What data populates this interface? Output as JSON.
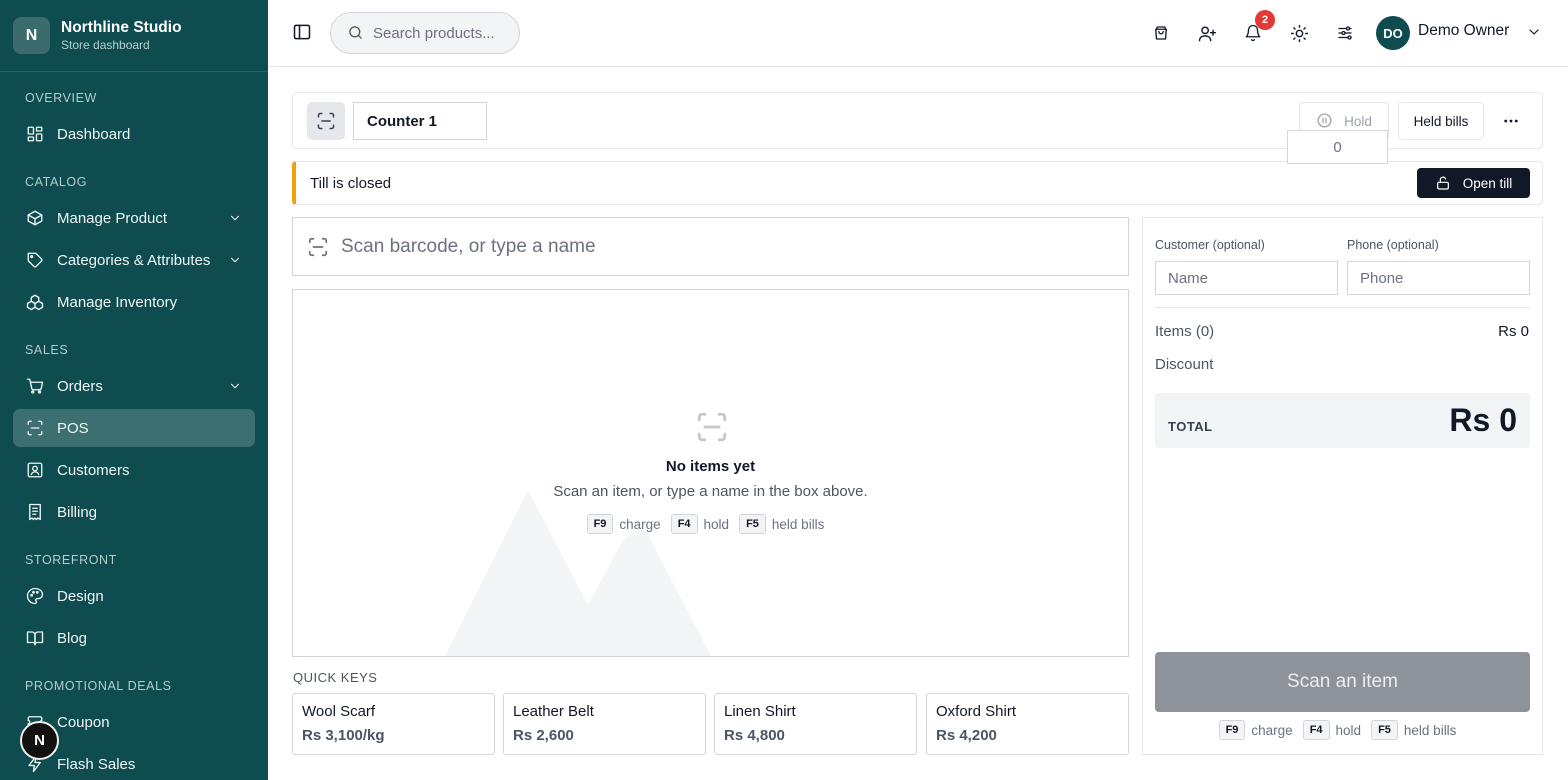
{
  "brand": {
    "initial": "N",
    "name": "Northline Studio",
    "subtitle": "Store dashboard"
  },
  "sidebar": {
    "sections": [
      {
        "label": "OVERVIEW"
      },
      {
        "label": "CATALOG"
      },
      {
        "label": "SALES"
      },
      {
        "label": "STOREFRONT"
      },
      {
        "label": "PROMOTIONAL DEALS"
      }
    ],
    "items": [
      {
        "label": "Dashboard",
        "icon": "grid-icon"
      },
      {
        "label": "Manage Product",
        "icon": "box-icon"
      },
      {
        "label": "Categories & Attributes",
        "icon": "tag-icon"
      },
      {
        "label": "Manage Inventory",
        "icon": "boxes-icon"
      },
      {
        "label": "Orders",
        "icon": "cart-icon"
      },
      {
        "label": "POS",
        "icon": "scan-icon"
      },
      {
        "label": "Customers",
        "icon": "contact-icon"
      },
      {
        "label": "Billing",
        "icon": "receipt-icon"
      },
      {
        "label": "Design",
        "icon": "palette-icon"
      },
      {
        "label": "Blog",
        "icon": "book-icon"
      },
      {
        "label": "Coupon",
        "icon": "ticket-icon"
      },
      {
        "label": "Flash Sales",
        "icon": "zap-icon"
      }
    ],
    "floating_avatar": "N"
  },
  "topbar": {
    "search_placeholder": "Search products...",
    "notification_count": "2",
    "user_initials": "DO",
    "user_name": "Demo Owner"
  },
  "counter": {
    "name": "Counter 1",
    "hold_label": "Hold",
    "held_bills_label": "Held bills"
  },
  "till": {
    "status": "Till is closed",
    "open_label": "Open till",
    "accent": "#f59e0b"
  },
  "scan": {
    "placeholder": "Scan barcode, or type a name"
  },
  "empty": {
    "title": "No items yet",
    "subtitle": "Scan an item, or type a name in the box above."
  },
  "shortcuts": [
    {
      "key": "F9",
      "label": "charge"
    },
    {
      "key": "F4",
      "label": "hold"
    },
    {
      "key": "F5",
      "label": "held bills"
    }
  ],
  "quick_keys": {
    "label": "QUICK KEYS",
    "items": [
      {
        "name": "Wool Scarf",
        "price": "Rs 3,100/kg"
      },
      {
        "name": "Leather Belt",
        "price": "Rs 2,600"
      },
      {
        "name": "Linen Shirt",
        "price": "Rs 4,800"
      },
      {
        "name": "Oxford Shirt",
        "price": "Rs 4,200"
      }
    ]
  },
  "customer": {
    "customer_label": "Customer (optional)",
    "name_placeholder": "Name",
    "phone_label": "Phone (optional)",
    "phone_placeholder": "Phone"
  },
  "summary": {
    "items_label": "Items (0)",
    "items_value": "Rs 0",
    "discount_label": "Discount",
    "discount_value": "0",
    "total_label": "TOTAL",
    "total_value": "Rs 0",
    "charge_label": "Scan an item"
  },
  "colors": {
    "sidebar": "#0f4c4f",
    "active": "#3d6e70",
    "badge": "#e53935"
  }
}
